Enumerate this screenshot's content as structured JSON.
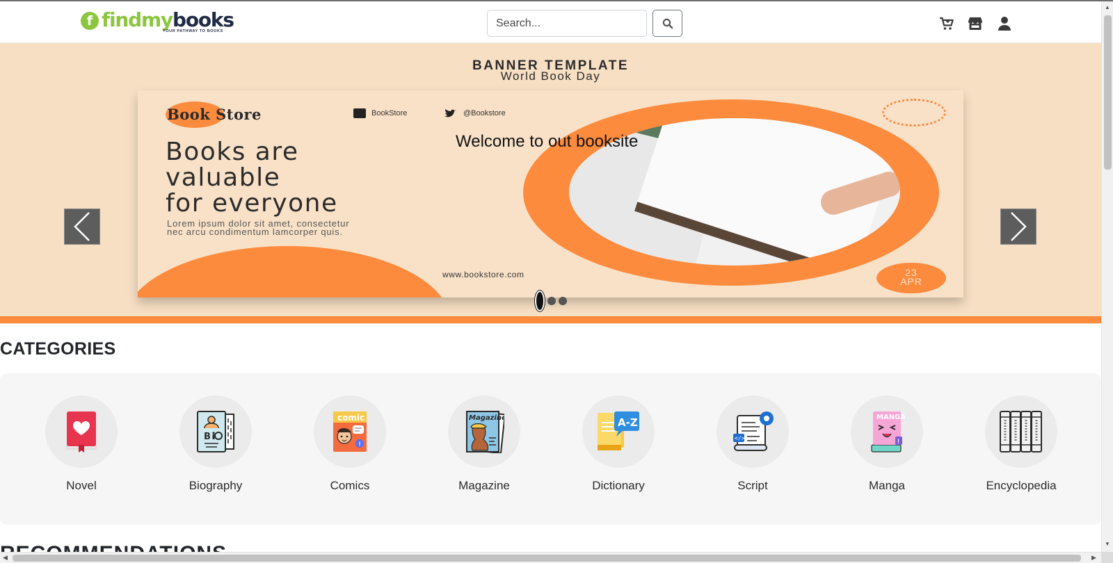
{
  "app": {
    "title": "findmybooks"
  },
  "header": {
    "logo_letter": "f",
    "logo_findmy": "findmy",
    "logo_books": "books",
    "logo_tagline": "YOUR PATHWAY TO BOOKS",
    "search_placeholder": "Search...",
    "icons": [
      "search-icon",
      "cart-icon",
      "store-icon",
      "user-icon"
    ]
  },
  "carousel": {
    "banner_title": "BANNER TEMPLATE",
    "banner_subtitle": "World Book Day",
    "brand": "Book Store",
    "facebook_handle": "BookStore",
    "twitter_handle": "@Bookstore",
    "headline_lines": [
      "Books are",
      "valuable",
      "for everyone"
    ],
    "lorem_lines": [
      "Lorem ipsum dolor sit amet, consectetur",
      "nec arcu condimentum lamcorper quis."
    ],
    "website": "www.bookstore.com",
    "date_day": "23",
    "date_month": "APR",
    "caption": "Welcome to out booksite",
    "slide_count": 3,
    "active_slide": 1
  },
  "categories": {
    "title": "CATEGORIES",
    "items": [
      {
        "label": "Novel",
        "icon": "novel-icon"
      },
      {
        "label": "Biography",
        "icon": "biography-icon"
      },
      {
        "label": "Comics",
        "icon": "comics-icon"
      },
      {
        "label": "Magazine",
        "icon": "magazine-icon"
      },
      {
        "label": "Dictionary",
        "icon": "dictionary-icon"
      },
      {
        "label": "Script",
        "icon": "script-icon"
      },
      {
        "label": "Manga",
        "icon": "manga-icon"
      },
      {
        "label": "Encyclopedia",
        "icon": "encyclopedia-icon"
      }
    ]
  },
  "recommendations": {
    "title": "RECOMMENDATIONS"
  },
  "colors": {
    "accent": "#fd8b3d",
    "logo_green": "#8cc63f",
    "logo_navy": "#1f2a44",
    "banner_bg": "#f7dfc4"
  }
}
